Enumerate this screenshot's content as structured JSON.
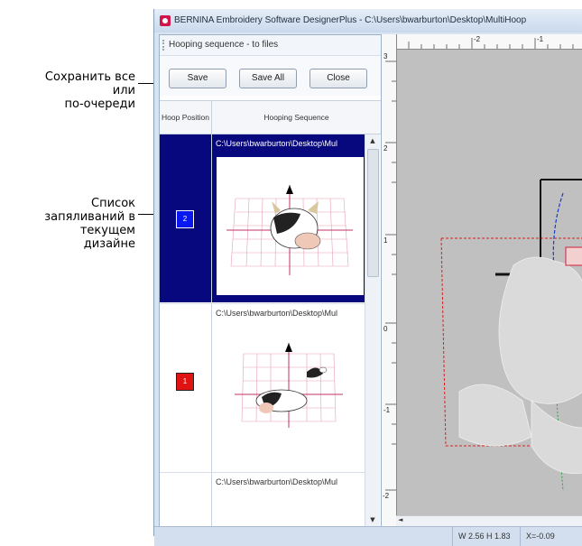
{
  "callouts": {
    "save_all": "Сохранить все\nили\nпо-очереди",
    "list": "Список\nзапяливаний в\nтекущем\nдизайне"
  },
  "window": {
    "title": "BERNINA Embroidery Software DesignerPlus - C:\\Users\\bwarburton\\Desktop\\MultiHoop",
    "app_icon": "bernina-logo-icon"
  },
  "panel": {
    "title": "Hooping sequence - to files",
    "buttons": {
      "save": "Save",
      "save_all": "Save All",
      "close": "Close"
    },
    "columns": {
      "position": "Hoop Position",
      "sequence": "Hooping Sequence"
    },
    "rows": [
      {
        "path": "C:\\Users\\bwarburton\\Desktop\\Mul",
        "position": "2",
        "badge_color": "#0a18f0",
        "selected": true
      },
      {
        "path": "C:\\Users\\bwarburton\\Desktop\\Mul",
        "position": "1",
        "badge_color": "#e01212",
        "selected": false
      },
      {
        "path": "C:\\Users\\bwarburton\\Desktop\\Mul",
        "position": "",
        "badge_color": "",
        "selected": false
      }
    ]
  },
  "ruler": {
    "top": [
      "-2",
      "-1"
    ],
    "left": [
      "3",
      "2",
      "1",
      "0",
      "-1",
      "-2"
    ]
  },
  "status": {
    "size": "W 2.56 H 1.83",
    "coords": "X=-0.09"
  },
  "colors": {
    "selection": "#08087e",
    "accent": "#d2144a"
  }
}
